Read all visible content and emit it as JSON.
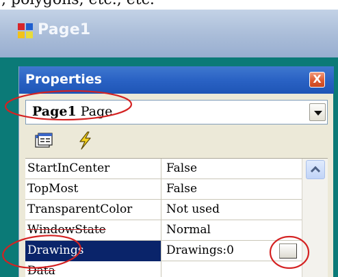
{
  "top_text": ", polygons, etc., etc.",
  "window": {
    "title": "Page1"
  },
  "properties": {
    "title": "Properties",
    "close_label": "X",
    "selector": {
      "object_name": "Page1",
      "object_type": "Page"
    },
    "toolbar": [
      {
        "name": "property-pages-icon"
      },
      {
        "name": "events-lightning-icon"
      }
    ],
    "rows": [
      {
        "name": "StartInCenter",
        "value": "False"
      },
      {
        "name": "TopMost",
        "value": "False"
      },
      {
        "name": "TransparentColor",
        "value": "Not used"
      },
      {
        "name": "WindowState",
        "value": "Normal"
      },
      {
        "name": "Drawings",
        "value": "Drawings:0",
        "selected": true
      },
      {
        "name": "Data",
        "value": ""
      }
    ]
  },
  "colors": {
    "panel_header": "#2a62c4",
    "selection": "#0a246a",
    "annotation_red": "#d42222",
    "page_teal": "#0b7a77"
  }
}
